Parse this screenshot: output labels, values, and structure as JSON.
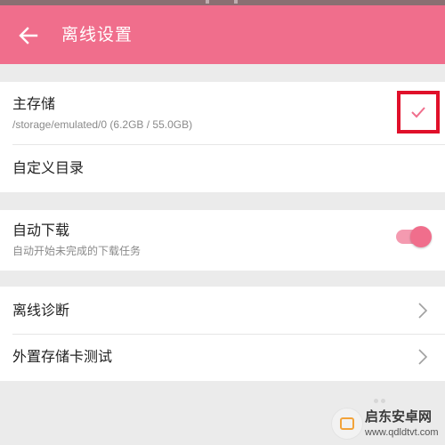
{
  "colors": {
    "accent": "#f06e8c",
    "highlight_frame": "#e0102a",
    "background": "#ebebeb"
  },
  "header": {
    "title": "离线设置",
    "back_icon": "arrow-left-icon"
  },
  "storage_section": {
    "primary_storage": {
      "label": "主存储",
      "path": "/storage/emulated/0 (6.2GB / 55.0GB)",
      "checked": true
    },
    "custom_directory": {
      "label": "自定义目录"
    }
  },
  "download_section": {
    "auto_download": {
      "label": "自动下载",
      "description": "自动开始未完成的下载任务",
      "enabled": true
    }
  },
  "tools_section": {
    "items": [
      {
        "label": "离线诊断",
        "icon": "chevron-right-icon"
      },
      {
        "label": "外置存储卡测试",
        "icon": "chevron-right-icon"
      }
    ]
  },
  "watermark": {
    "name": "启东安卓网",
    "url": "www.qdldtvt.com"
  }
}
